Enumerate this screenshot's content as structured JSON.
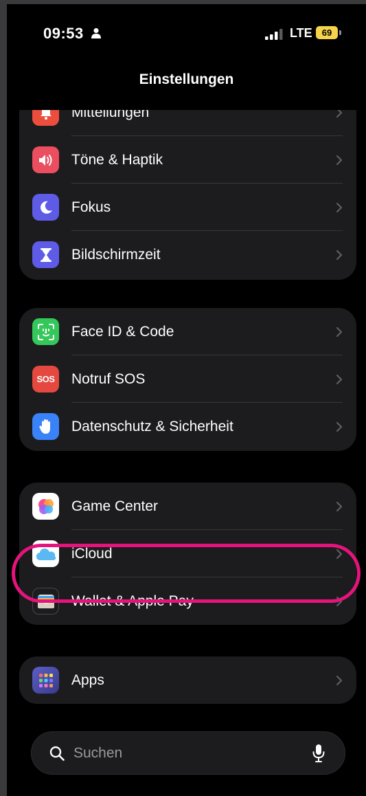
{
  "status_bar": {
    "time": "09:53",
    "network": "LTE",
    "battery_level": "69",
    "battery_color": "#f5d34a",
    "icons": [
      "person-icon",
      "cellular-signal-icon",
      "battery-icon"
    ]
  },
  "nav": {
    "title": "Einstellungen"
  },
  "groups": [
    {
      "items": [
        {
          "label": "Mitteilungen",
          "icon": "bell-icon",
          "icon_color": "#eb4e3d"
        },
        {
          "label": "Töne & Haptik",
          "icon": "speaker-icon",
          "icon_color": "#eb4e5e"
        },
        {
          "label": "Fokus",
          "icon": "moon-icon",
          "icon_color": "#5e5ce6"
        },
        {
          "label": "Bildschirmzeit",
          "icon": "hourglass-icon",
          "icon_color": "#5e5ce6"
        }
      ]
    },
    {
      "items": [
        {
          "label": "Face ID & Code",
          "icon": "face-id-icon",
          "icon_color": "#34c759"
        },
        {
          "label": "Notruf SOS",
          "icon": "sos-icon",
          "icon_color": "#e5483e",
          "icon_text": "SOS"
        },
        {
          "label": "Datenschutz & Sicherheit",
          "icon": "hand-icon",
          "icon_color": "#3a82f7"
        }
      ]
    },
    {
      "items": [
        {
          "label": "Game Center",
          "icon": "game-center-icon",
          "icon_color": "#ffffff"
        },
        {
          "label": "iCloud",
          "icon": "cloud-icon",
          "icon_color": "#ffffff"
        },
        {
          "label": "Wallet & Apple Pay",
          "icon": "wallet-icon",
          "icon_color": "#1c1c1e"
        }
      ]
    },
    {
      "items": [
        {
          "label": "Apps",
          "icon": "apps-grid-icon",
          "icon_color": "#5b5fc7"
        }
      ]
    }
  ],
  "highlight_color": "#e7137c",
  "search": {
    "placeholder": "Suchen"
  }
}
